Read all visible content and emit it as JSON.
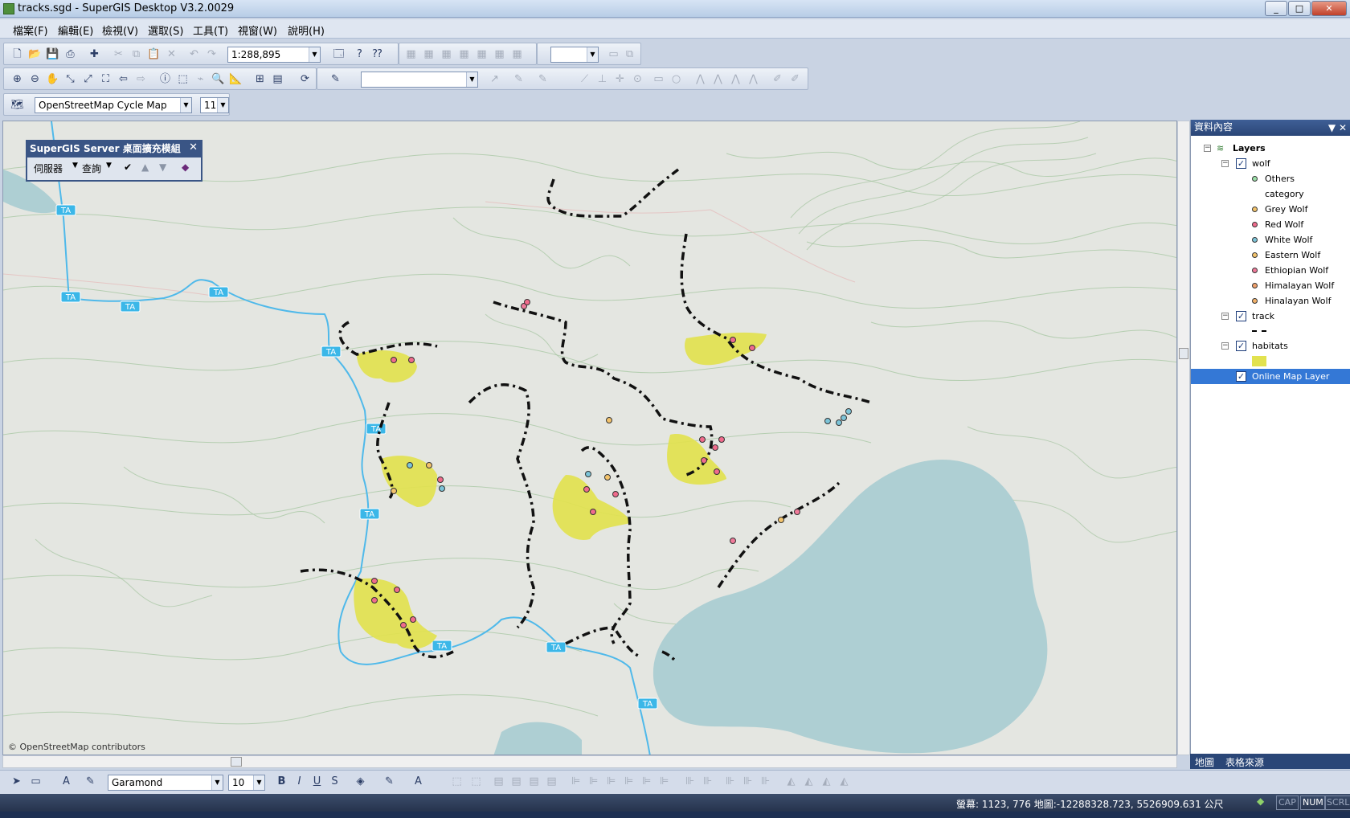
{
  "window": {
    "title": "tracks.sgd - SuperGIS Desktop V3.2.0029"
  },
  "menu": [
    "檔案(F)",
    "編輯(E)",
    "檢視(V)",
    "選取(S)",
    "工具(T)",
    "視窗(W)",
    "說明(H)"
  ],
  "toolbar": {
    "scale_value": "1:288,895",
    "basemap_value": "OpenStreetMap Cycle Map",
    "zoom_value": "11",
    "font_value": "Garamond",
    "font_size_value": "10"
  },
  "server_toolbar": {
    "title": "SuperGIS Server 桌面擴充模組",
    "server_label": "伺服器",
    "query_label": "查詢"
  },
  "map": {
    "attribution": "© OpenStreetMap contributors",
    "road_label": "TA"
  },
  "toc": {
    "title": "資料內容",
    "root": "Layers",
    "wolf": {
      "name": "wolf",
      "legend": [
        {
          "label": "Others",
          "color": "#9be0a8"
        },
        {
          "label": "category",
          "color": ""
        },
        {
          "label": "Grey Wolf",
          "color": "#f3c36b"
        },
        {
          "label": "Red Wolf",
          "color": "#f06b8c"
        },
        {
          "label": "White Wolf",
          "color": "#7cc4d8"
        },
        {
          "label": "Eastern Wolf",
          "color": "#f3c36b"
        },
        {
          "label": "Ethiopian Wolf",
          "color": "#f07a9a"
        },
        {
          "label": "Himalayan Wolf",
          "color": "#f0a06b"
        },
        {
          "label": "Hinalayan Wolf",
          "color": "#f3b26b"
        }
      ]
    },
    "track": {
      "name": "track"
    },
    "habitats": {
      "name": "habitats",
      "fill": "#e2e24f"
    },
    "online": {
      "name": "Online Map Layer"
    },
    "tab_map": "地圖",
    "tab_source": "表格來源"
  },
  "status": {
    "coords": "螢幕: 1123, 776  地圖:-12288328.723, 5526909.631 公尺",
    "cap": "CAP",
    "num": "NUM",
    "scrl": "SCRL"
  }
}
